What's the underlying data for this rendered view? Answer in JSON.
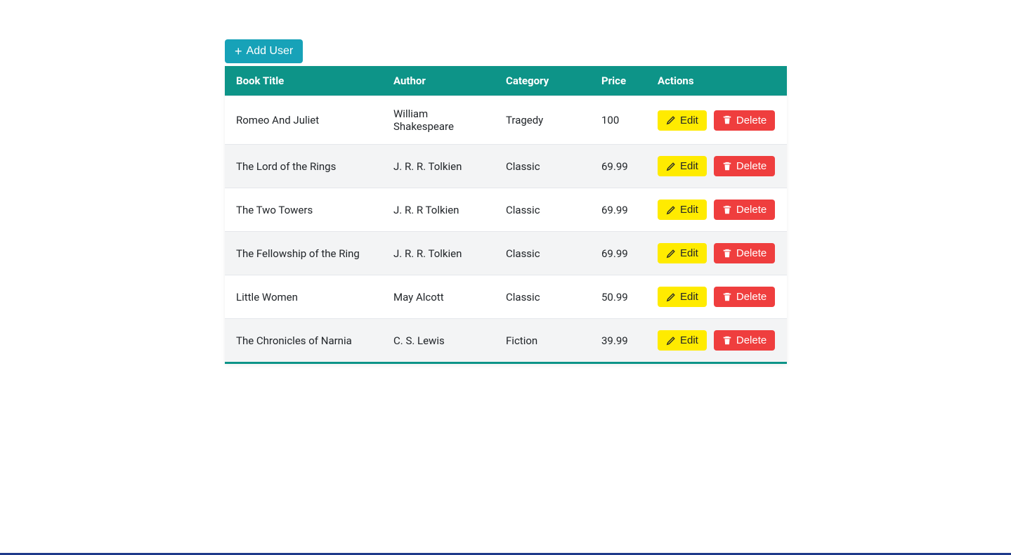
{
  "buttons": {
    "add_user": "Add User",
    "edit": "Edit",
    "delete": "Delete"
  },
  "table": {
    "headers": {
      "title": "Book Title",
      "author": "Author",
      "category": "Category",
      "price": "Price",
      "actions": "Actions"
    },
    "rows": [
      {
        "title": "Romeo And Juliet",
        "author": "William Shakespeare",
        "category": "Tragedy",
        "price": "100"
      },
      {
        "title": "The Lord of the Rings",
        "author": "J. R. R. Tolkien",
        "category": "Classic",
        "price": "69.99"
      },
      {
        "title": "The Two Towers",
        "author": "J. R. R Tolkien",
        "category": "Classic",
        "price": "69.99"
      },
      {
        "title": "The Fellowship of the Ring",
        "author": "J. R. R. Tolkien",
        "category": "Classic",
        "price": "69.99"
      },
      {
        "title": "Little Women",
        "author": "May Alcott",
        "category": "Classic",
        "price": "50.99"
      },
      {
        "title": "The Chronicles of Narnia",
        "author": "C. S. Lewis",
        "category": "Fiction",
        "price": "39.99"
      }
    ]
  }
}
